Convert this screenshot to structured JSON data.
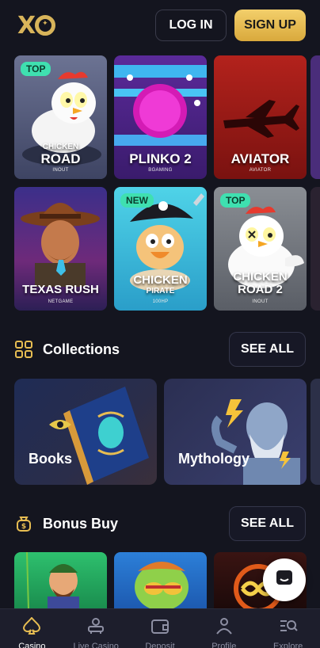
{
  "header": {
    "logo": "XO",
    "login_label": "LOG IN",
    "signup_label": "SIGN UP"
  },
  "games_row1": [
    {
      "name": "CHICKEN ROAD",
      "name_top": "CHICKEN",
      "name_main": "ROAD",
      "provider": "INOUT",
      "badge": "TOP"
    },
    {
      "name": "PLINKO 2",
      "provider": "BGAMING",
      "badge": ""
    },
    {
      "name": "AVIATOR",
      "provider": "AVIATOR",
      "badge": ""
    }
  ],
  "games_row2": [
    {
      "name": "TEXAS RUSH",
      "provider": "NETGAME",
      "badge": ""
    },
    {
      "name_top": "CHICKEN",
      "name_main": "PIRATE",
      "provider": "100HP",
      "badge": "NEW"
    },
    {
      "name_top": "CHICKEN",
      "name_main": "ROAD 2",
      "provider": "INOUT",
      "badge": "TOP"
    }
  ],
  "collections": {
    "title": "Collections",
    "see_all": "SEE ALL",
    "items": [
      {
        "label": "Books"
      },
      {
        "label": "Mythology"
      }
    ]
  },
  "bonus_buy": {
    "title": "Bonus Buy",
    "see_all": "SEE ALL"
  },
  "bottom_nav": [
    {
      "label": "Casino",
      "icon": "spade-icon",
      "active": true
    },
    {
      "label": "Live Casino",
      "icon": "dealer-icon",
      "active": false
    },
    {
      "label": "Deposit",
      "icon": "wallet-icon",
      "active": false
    },
    {
      "label": "Profile",
      "icon": "user-icon",
      "active": false
    },
    {
      "label": "Explore",
      "icon": "search-icon",
      "active": false
    }
  ],
  "colors": {
    "background": "#14151f",
    "accent_gold": "#e7bd52",
    "badge_green": "#3fe0b0"
  }
}
